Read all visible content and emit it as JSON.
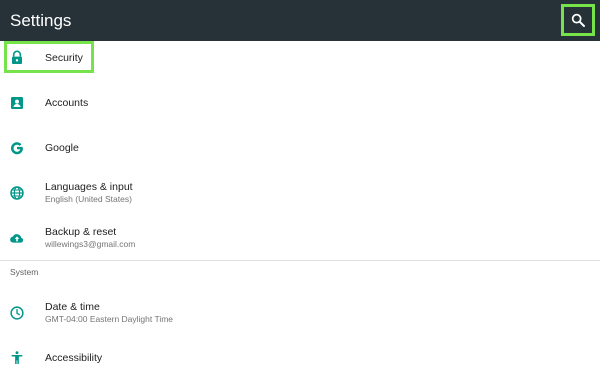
{
  "app_bar": {
    "title": "Settings",
    "search_icon": "search-icon",
    "background": "#263238"
  },
  "accent_color": "#009688",
  "highlight_color": "#76e34a",
  "items": [
    {
      "title": "Security",
      "subtitle": "",
      "icon": "lock-icon"
    },
    {
      "title": "Accounts",
      "subtitle": "",
      "icon": "account-box-icon"
    },
    {
      "title": "Google",
      "subtitle": "",
      "icon": "google-icon"
    },
    {
      "title": "Languages & input",
      "subtitle": "English (United States)",
      "icon": "globe-icon"
    },
    {
      "title": "Backup & reset",
      "subtitle": "willewings3@gmail.com",
      "icon": "cloud-upload-icon"
    }
  ],
  "system_section": {
    "header": "System",
    "items": [
      {
        "title": "Date & time",
        "subtitle": "GMT-04:00 Eastern Daylight Time",
        "icon": "clock-icon"
      },
      {
        "title": "Accessibility",
        "subtitle": "",
        "icon": "accessibility-icon"
      }
    ]
  }
}
